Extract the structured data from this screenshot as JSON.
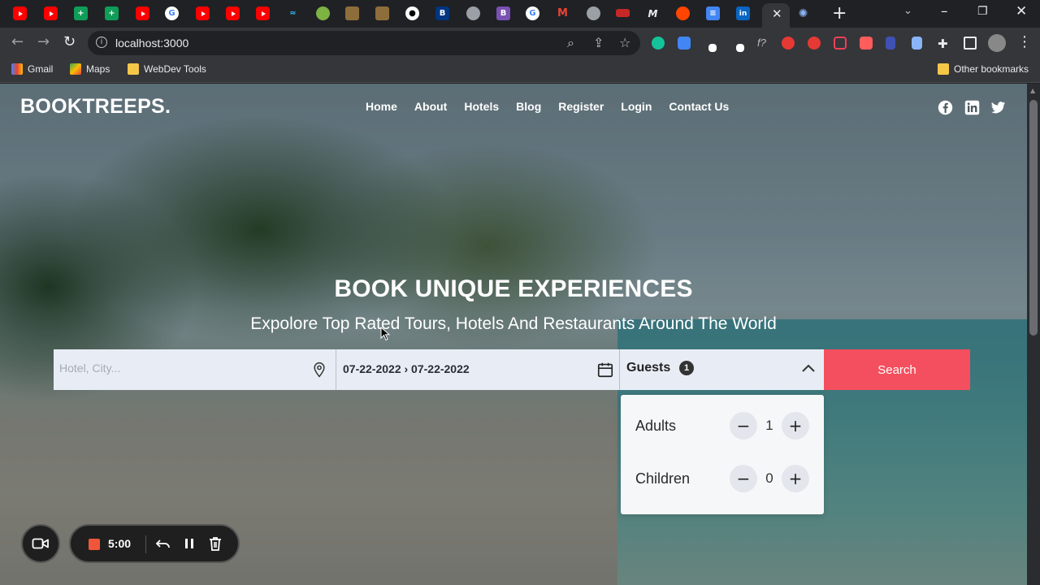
{
  "browser": {
    "url": "localhost:3000",
    "bookmarks": [
      {
        "label": "Gmail"
      },
      {
        "label": "Maps"
      },
      {
        "label": "WebDev Tools"
      }
    ],
    "other_bookmarks": "Other bookmarks",
    "tab_close": "✕",
    "new_tab": "+"
  },
  "site": {
    "brand": "BOOKTREEPS.",
    "nav": [
      "Home",
      "About",
      "Hotels",
      "Blog",
      "Register",
      "Login",
      "Contact Us"
    ]
  },
  "hero": {
    "title": "BOOK UNIQUE EXPERIENCES",
    "subtitle": "Expolore Top Rated Tours, Hotels And Restaurants Around The World"
  },
  "search": {
    "location_placeholder": "Hotel, City...",
    "dates": "07-22-2022 › 07-22-2022",
    "guests_label": "Guests",
    "guests_count": "1",
    "button": "Search"
  },
  "guests_popup": {
    "adults_label": "Adults",
    "adults_value": "1",
    "children_label": "Children",
    "children_value": "0"
  },
  "recorder": {
    "time": "5:00"
  }
}
